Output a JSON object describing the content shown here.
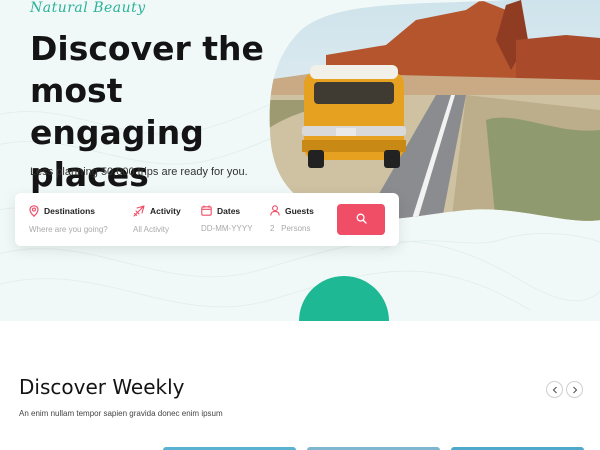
{
  "hero": {
    "tagline": "Natural Beauty",
    "title": "Discover the most engaging places",
    "subtitle": "Less planning 50,000 trips are ready for you."
  },
  "search": {
    "fields": [
      {
        "label": "Destinations",
        "placeholder": "Where are you going?",
        "icon": "map-pin-icon"
      },
      {
        "label": "Activity",
        "placeholder": "All Activity",
        "icon": "airplane-icon"
      },
      {
        "label": "Dates",
        "placeholder": "DD-MM-YYYY",
        "icon": "calendar-icon"
      },
      {
        "label": "Guests",
        "count": "2",
        "unit": "Persons",
        "icon": "user-icon"
      }
    ],
    "button_icon": "search-icon"
  },
  "weekly": {
    "title": "Discover Weekly",
    "subtitle": "An enim nullam tempor sapien gravida donec enim ipsum",
    "prev_icon": "chevron-left-icon",
    "next_icon": "chevron-right-icon"
  },
  "colors": {
    "accent": "#f04d67",
    "teal": "#2bb39a",
    "green": "#1fb894",
    "yellow": "#f8c63c",
    "hero_bg": "#f1f9f8"
  }
}
